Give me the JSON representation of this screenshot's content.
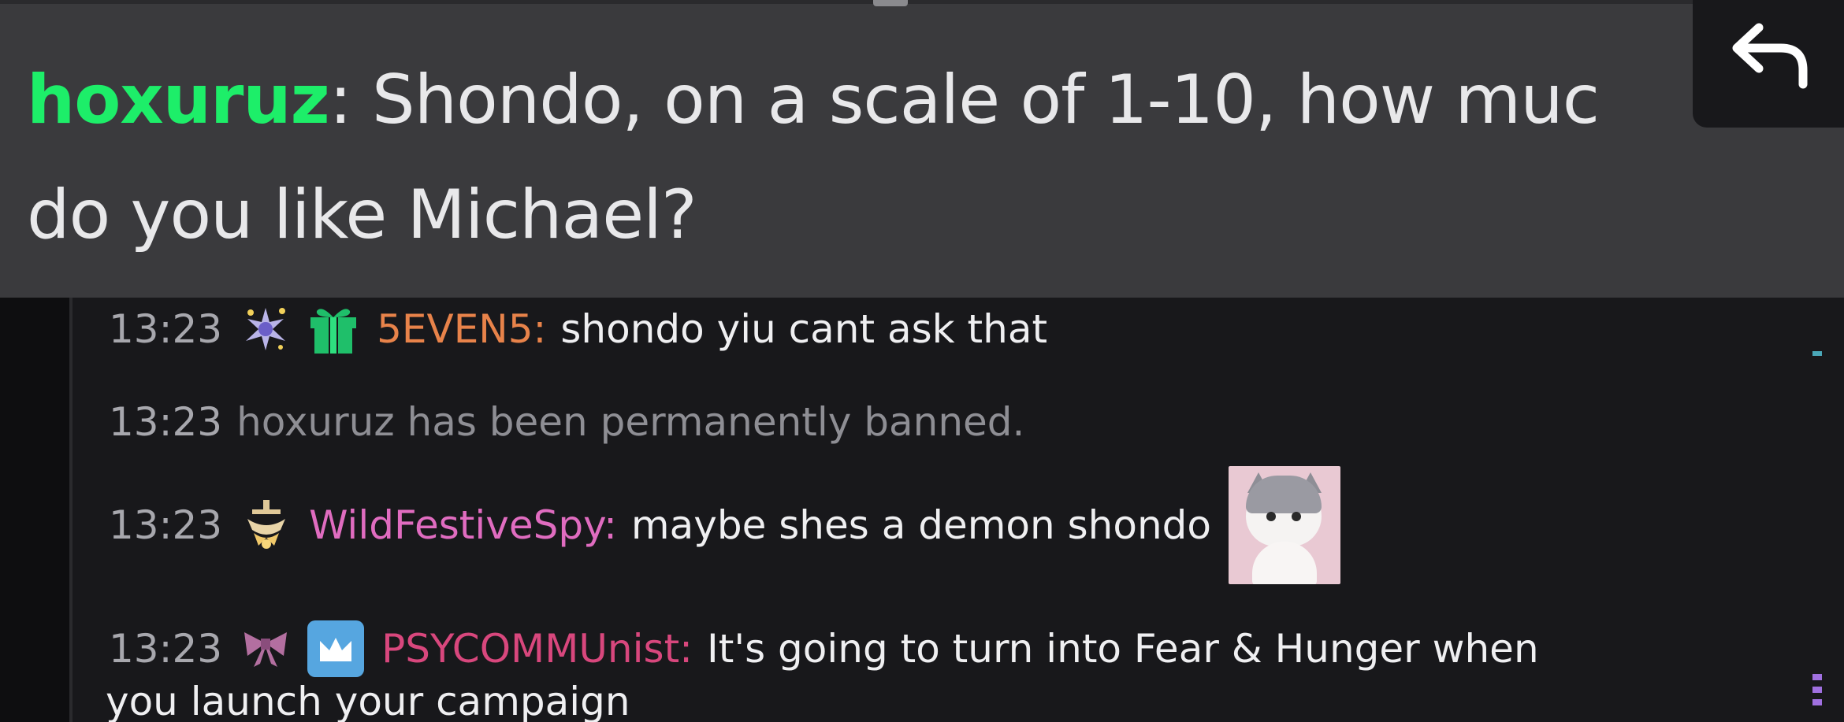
{
  "pinned_message": {
    "username": "hoxuruz",
    "separator": ":",
    "text_line1": " Shondo, on a scale of 1-10, how muc",
    "text_line2": "do you like Michael?",
    "username_color": "#1dee69"
  },
  "reply_button": {
    "icon": "reply-arrow-icon"
  },
  "chat": {
    "messages": [
      {
        "time": "13:23",
        "badges": [
          "sparkle-star-badge-icon",
          "gift-badge-icon"
        ],
        "username": "5EVEN5:",
        "username_color": "#e8834a",
        "text": "shondo yiu cant ask that"
      },
      {
        "time": "13:23",
        "system_text": "hoxuruz has been permanently banned."
      },
      {
        "time": "13:23",
        "badges": [
          "chandelier-badge-icon"
        ],
        "username": "WildFestiveSpy:",
        "username_color": "#e06cc0",
        "text": "maybe shes a demon shondo",
        "emote": "kitten-emote"
      },
      {
        "time": "13:23",
        "badges": [
          "bow-badge-icon",
          "crown-badge-icon"
        ],
        "username": "PSYCOMMUnist:",
        "username_color": "#d8477d",
        "text": "It's going to turn into Fear & Hunger when",
        "text_cont": "you launch your campaign"
      }
    ]
  },
  "colors": {
    "pinned_bg": "#3a3a3d",
    "chat_bg": "#18181b",
    "timestamp": "#a7a7ad",
    "system_text": "#8e8e94",
    "message_text": "#efeff1"
  }
}
